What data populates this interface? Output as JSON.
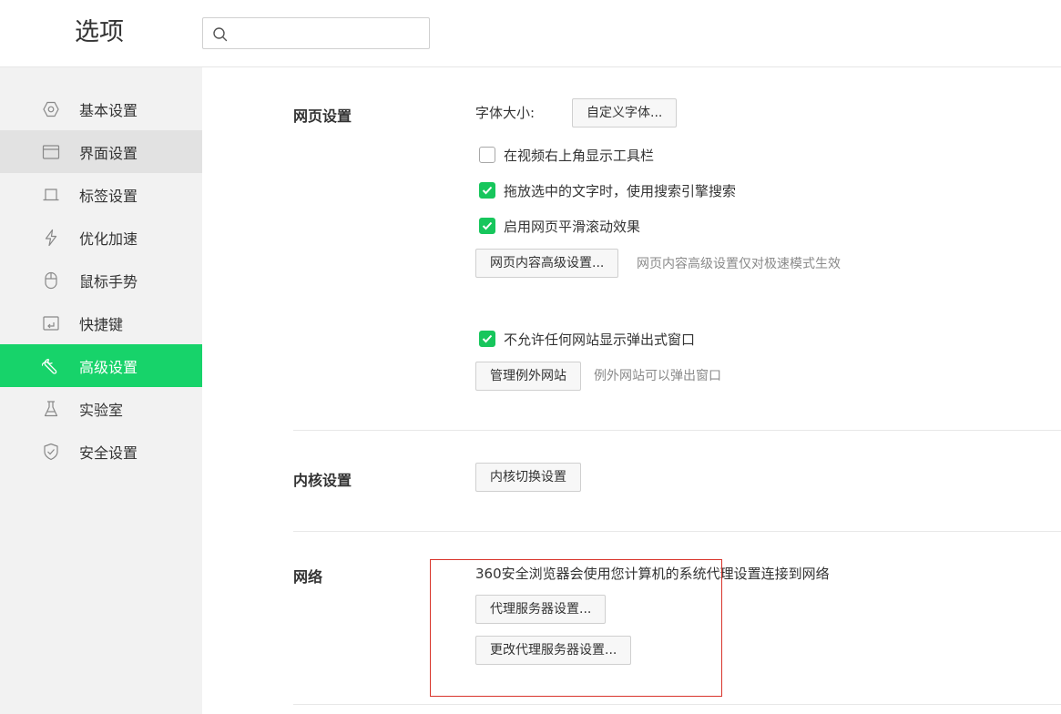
{
  "header": {
    "title": "选项",
    "search": {
      "placeholder": "",
      "value": ""
    }
  },
  "sidebar": {
    "items": [
      {
        "label": "基本设置",
        "icon": "hexagon-settings-icon",
        "state": "normal"
      },
      {
        "label": "界面设置",
        "icon": "window-icon",
        "state": "hover"
      },
      {
        "label": "标签设置",
        "icon": "tab-icon",
        "state": "normal"
      },
      {
        "label": "优化加速",
        "icon": "lightning-icon",
        "state": "normal"
      },
      {
        "label": "鼠标手势",
        "icon": "mouse-icon",
        "state": "normal"
      },
      {
        "label": "快捷键",
        "icon": "keyboard-shortcut-icon",
        "state": "normal"
      },
      {
        "label": "高级设置",
        "icon": "wrench-icon",
        "state": "active"
      },
      {
        "label": "实验室",
        "icon": "flask-icon",
        "state": "normal"
      },
      {
        "label": "安全设置",
        "icon": "shield-icon",
        "state": "normal"
      }
    ]
  },
  "webpage": {
    "title": "网页设置",
    "font_size_label": "字体大小:",
    "custom_font_button": "自定义字体...",
    "checkboxes": [
      {
        "label": "在视频右上角显示工具栏",
        "checked": false
      },
      {
        "label": "拖放选中的文字时，使用搜索引擎搜索",
        "checked": true
      },
      {
        "label": "启用网页平滑滚动效果",
        "checked": true
      }
    ],
    "advanced_button": "网页内容高级设置...",
    "advanced_hint": "网页内容高级设置仅对极速模式生效",
    "popup_checkbox": {
      "label": "不允许任何网站显示弹出式窗口",
      "checked": true
    },
    "exceptions_button": "管理例外网站",
    "exceptions_hint": "例外网站可以弹出窗口"
  },
  "kernel": {
    "title": "内核设置",
    "switch_button": "内核切换设置"
  },
  "network": {
    "title": "网络",
    "description": "360安全浏览器会使用您计算机的系统代理设置连接到网络",
    "proxy_button": "代理服务器设置...",
    "change_proxy_button": "更改代理服务器设置..."
  },
  "colors": {
    "accent": "#17d36a",
    "checkbox": "#17c65c",
    "highlight_box": "#d9342b"
  }
}
